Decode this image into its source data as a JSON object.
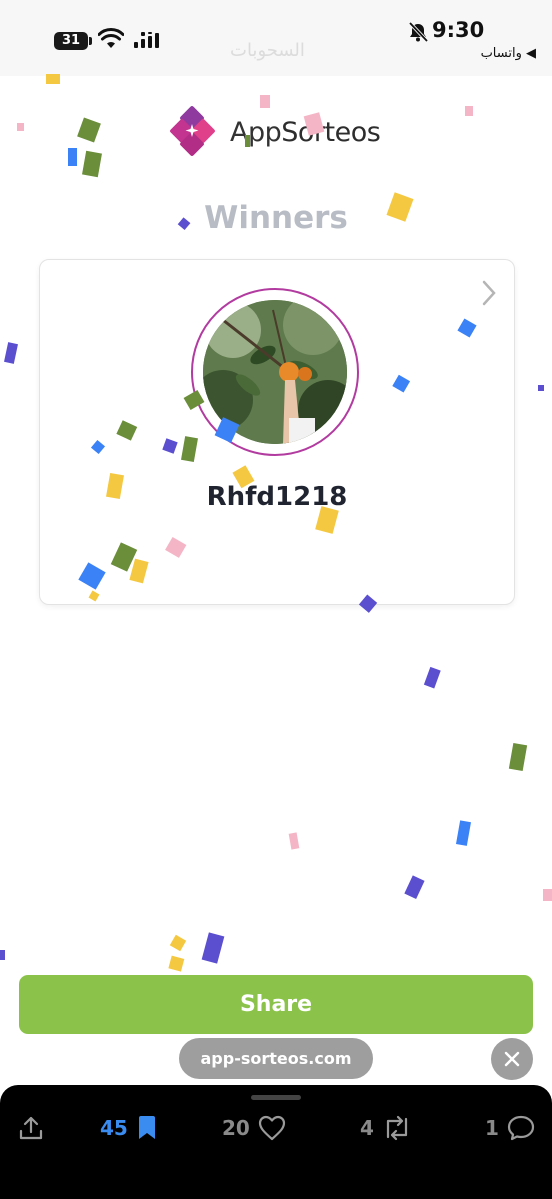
{
  "status_bar": {
    "battery": "31",
    "time": "9:30",
    "back_app": "◀ واتساب",
    "faded_title": "السحوبات"
  },
  "logo": {
    "text_part1": "App",
    "text_part2": "Sorteos"
  },
  "page_title": "Winners",
  "winner": {
    "username": "Rhfd1218"
  },
  "share_label": "Share",
  "url": "app-sorteos.com",
  "bottom_bar": {
    "bookmark_count": "45",
    "like_count": "20",
    "repost_count": "4",
    "comment_count": "1"
  },
  "colors": {
    "accent_green": "#8bc34a",
    "logo_magenta": "#b23ba0",
    "saved_blue": "#3b8cf0"
  }
}
